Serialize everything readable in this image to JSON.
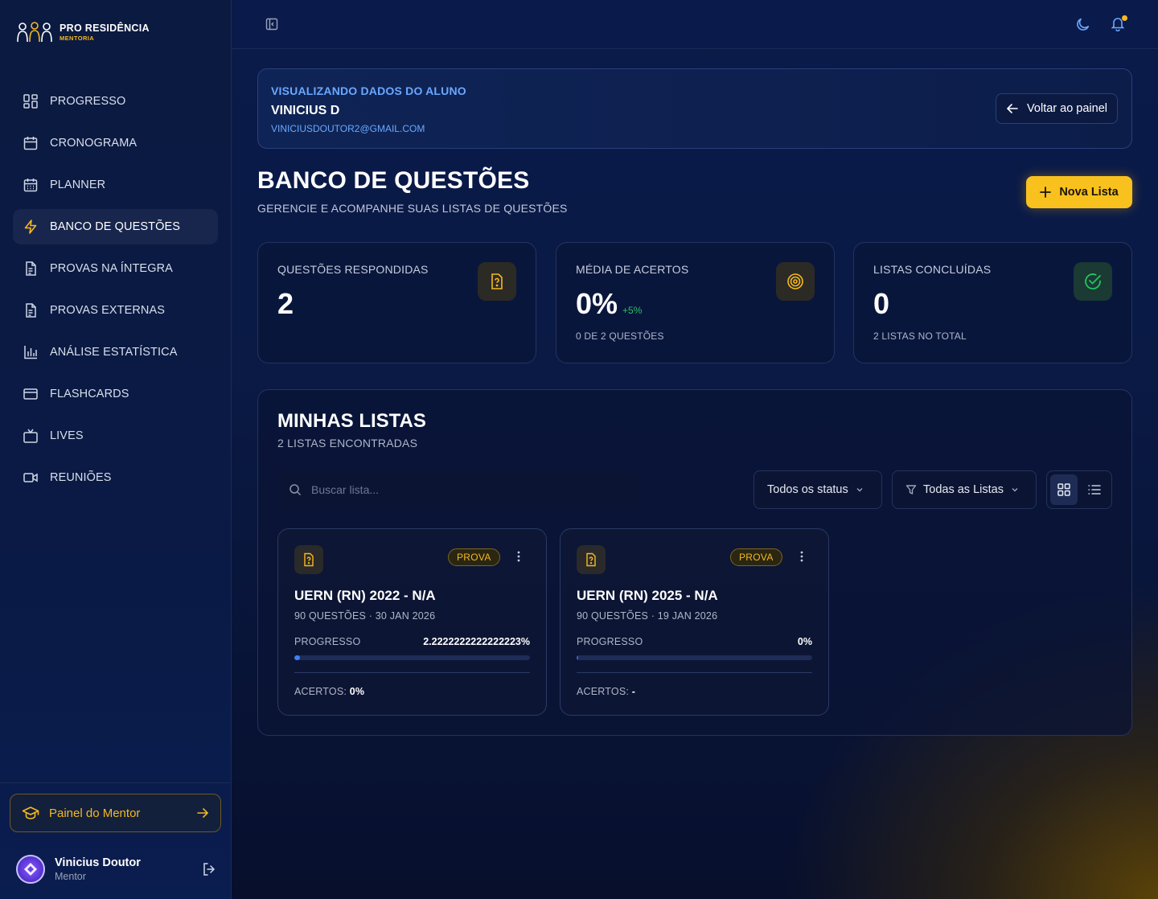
{
  "brand": {
    "name": "PRO RESIDÊNCIA",
    "tagline": "MENTORIA"
  },
  "sidebar": {
    "items": [
      {
        "label": "PROGRESSO",
        "icon": "grid-icon"
      },
      {
        "label": "CRONOGRAMA",
        "icon": "calendar-icon"
      },
      {
        "label": "PLANNER",
        "icon": "calendar-grid-icon"
      },
      {
        "label": "BANCO DE QUESTÕES",
        "icon": "lightning-icon",
        "active": true
      },
      {
        "label": "PROVAS NA ÍNTEGRA",
        "icon": "document-icon"
      },
      {
        "label": "PROVAS EXTERNAS",
        "icon": "document-icon"
      },
      {
        "label": "ANÁLISE ESTATÍSTICA",
        "icon": "bar-chart-icon"
      },
      {
        "label": "FLASHCARDS",
        "icon": "card-icon"
      },
      {
        "label": "LIVES",
        "icon": "tv-icon"
      },
      {
        "label": "REUNIÕES",
        "icon": "video-icon"
      }
    ],
    "mentor_button": "Painel do Mentor",
    "user": {
      "name": "Vinicius Doutor",
      "role": "Mentor"
    }
  },
  "student_banner": {
    "label": "VISUALIZANDO DADOS DO ALUNO",
    "name": "VINICIUS D",
    "email": "VINICIUSDOUTOR2@GMAIL.COM",
    "back_button": "Voltar ao painel"
  },
  "page": {
    "title": "BANCO DE QUESTÕES",
    "subtitle": "GERENCIE E ACOMPANHE SUAS LISTAS DE QUESTÕES",
    "new_list_button": "Nova Lista"
  },
  "stats": [
    {
      "label": "QUESTÕES RESPONDIDAS",
      "value": "2",
      "delta": "",
      "note": ""
    },
    {
      "label": "MÉDIA DE ACERTOS",
      "value": "0%",
      "delta": "+5%",
      "note": "0 DE 2 QUESTÕES"
    },
    {
      "label": "LISTAS CONCLUÍDAS",
      "value": "0",
      "delta": "",
      "note": "2 LISTAS NO TOTAL"
    }
  ],
  "lists": {
    "title": "MINHAS LISTAS",
    "count": "2 LISTAS ENCONTRADAS",
    "search_placeholder": "Buscar lista...",
    "status_filter": "Todos os status",
    "list_filter": "Todas as Listas",
    "cards": [
      {
        "badge": "PROVA",
        "title": "UERN (RN) 2022 - N/A",
        "meta": "90 QUESTÕES · 30 JAN 2026",
        "progress_label": "PROGRESSO",
        "progress_text": "2.2222222222222223%",
        "progress_value": 2.2222222222222223,
        "hits_label": "ACERTOS:",
        "hits_value": "0%"
      },
      {
        "badge": "PROVA",
        "title": "UERN (RN) 2025 - N/A",
        "meta": "90 QUESTÕES · 19 JAN 2026",
        "progress_label": "PROGRESSO",
        "progress_text": "0%",
        "progress_value": 0,
        "hits_label": "ACERTOS:",
        "hits_value": "-"
      }
    ]
  },
  "colors": {
    "accent": "#f8c11d",
    "link": "#6aa8ff",
    "success": "#22c55e",
    "progress": "#3b82f6"
  }
}
